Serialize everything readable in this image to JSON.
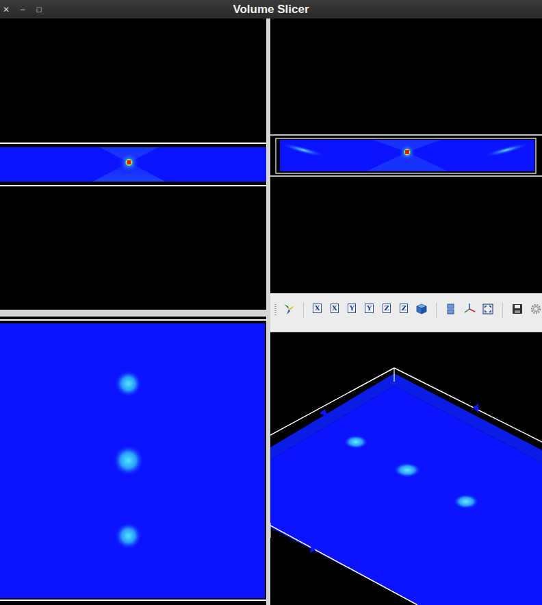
{
  "window": {
    "title": "Volume Slicer",
    "controls": [
      "✕",
      "–",
      "□"
    ]
  },
  "toolbar": {
    "view_buttons": [
      {
        "label": "X"
      },
      {
        "label": "X"
      },
      {
        "label": "Y"
      },
      {
        "label": "Y"
      },
      {
        "label": "Z"
      },
      {
        "label": "Z"
      }
    ]
  }
}
